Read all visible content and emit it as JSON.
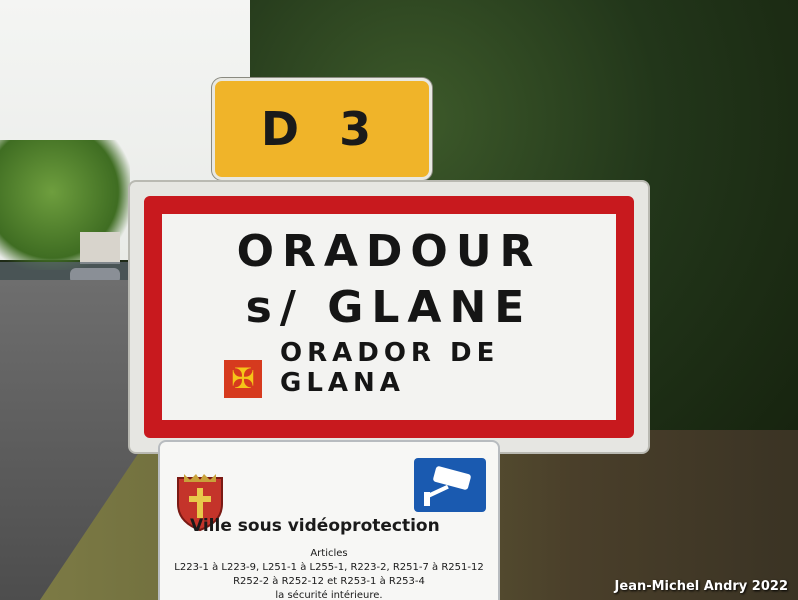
{
  "route_sign": {
    "text": "D 3",
    "color": "#f0b429"
  },
  "city_sign": {
    "line1": "ORADOUR",
    "line2": "s/ GLANE",
    "line3": "ORADOR DE GLANA",
    "border_color": "#c8191e",
    "emblem": "occitan-cross-flag-icon"
  },
  "video_sign": {
    "title": "Ville sous vidéoprotection",
    "subtitle": "Articles",
    "line1": "L223-1 à L223-9, L251-1 à L255-1, R223-2, R251-7 à R251-12",
    "line2": "R252-2 à R252-12 et R253-1 à R253-4",
    "line3": "la sécurité intérieure.",
    "icon": "surveillance-camera-icon",
    "crest": "coat-of-arms-icon"
  },
  "credit": "Jean-Michel Andry 2022"
}
